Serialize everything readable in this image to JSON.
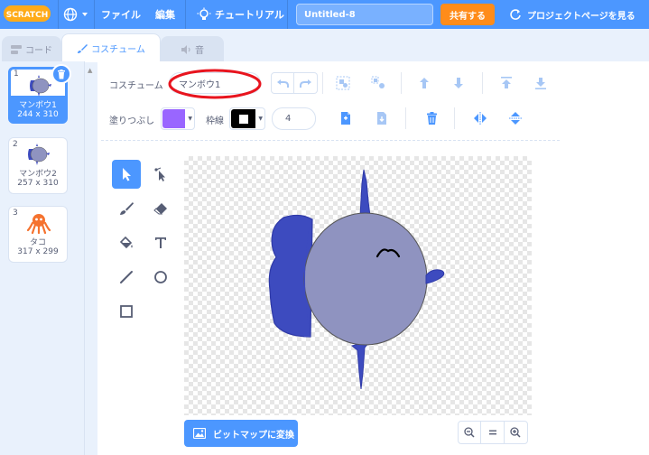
{
  "menubar": {
    "logo_text": "SCRATCH",
    "file": "ファイル",
    "edit": "編集",
    "tutorials": "チュートリアル",
    "project_title": "Untitled-8",
    "share": "共有する",
    "project_page": "プロジェクトページを見る"
  },
  "tabs": {
    "code": "コード",
    "costumes": "コスチューム",
    "sounds": "音"
  },
  "costumes": [
    {
      "num": "1",
      "name": "マンボウ1",
      "size": "244 x 310",
      "selected": true
    },
    {
      "num": "2",
      "name": "マンボウ2",
      "size": "257 x 310",
      "selected": false
    },
    {
      "num": "3",
      "name": "タコ",
      "size": "317 x 299",
      "selected": false
    }
  ],
  "editor": {
    "costume_label": "コスチューム",
    "costume_name": "マンボウ1",
    "fill_label": "塗りつぶし",
    "outline_label": "枠線",
    "outline_width": "4",
    "fill_color": "#9966ff",
    "outline_color": "#000000",
    "convert_bitmap": "ビットマップに変換"
  },
  "colors": {
    "accent": "#4c97ff",
    "share": "#ff8c1a",
    "annotation": "#e8141e",
    "fish_body": "#8f93c0",
    "fish_blue": "#3d4bbf"
  }
}
